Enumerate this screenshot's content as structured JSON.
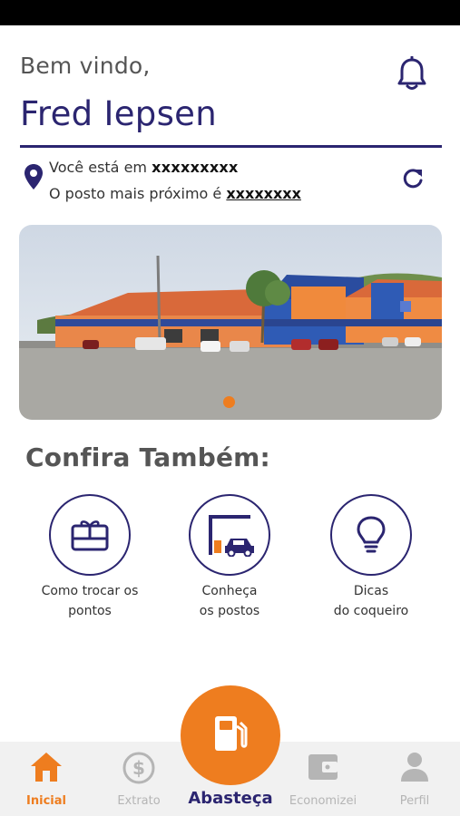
{
  "header": {
    "greeting": "Bem vindo,",
    "user_name": "Fred Iepsen"
  },
  "location": {
    "line1_prefix": "Você está em",
    "line1_value": "xxxxxxxxx",
    "line2_prefix": "O posto mais próximo é",
    "line2_value": "xxxxxxxx"
  },
  "carousel": {
    "slide_count": 1,
    "active_index": 0
  },
  "section": {
    "title": "Confira Também:"
  },
  "features": [
    {
      "line1": "Como trocar os",
      "line2": "pontos",
      "icon": "gift-card-icon"
    },
    {
      "line1": "Conheça",
      "line2": "os postos",
      "icon": "gas-station-car-icon"
    },
    {
      "line1": "Dicas",
      "line2": "do coqueiro",
      "icon": "lightbulb-icon"
    }
  ],
  "nav": {
    "inicial": "Inicial",
    "extrato": "Extrato",
    "abasteca": "Abasteça",
    "economizei": "Economizei",
    "perfil": "Perfil"
  },
  "colors": {
    "primary": "#2b2570",
    "accent": "#ee7d1f",
    "inactive": "#b5b5b5",
    "nav_bg": "#f1f1f1"
  }
}
